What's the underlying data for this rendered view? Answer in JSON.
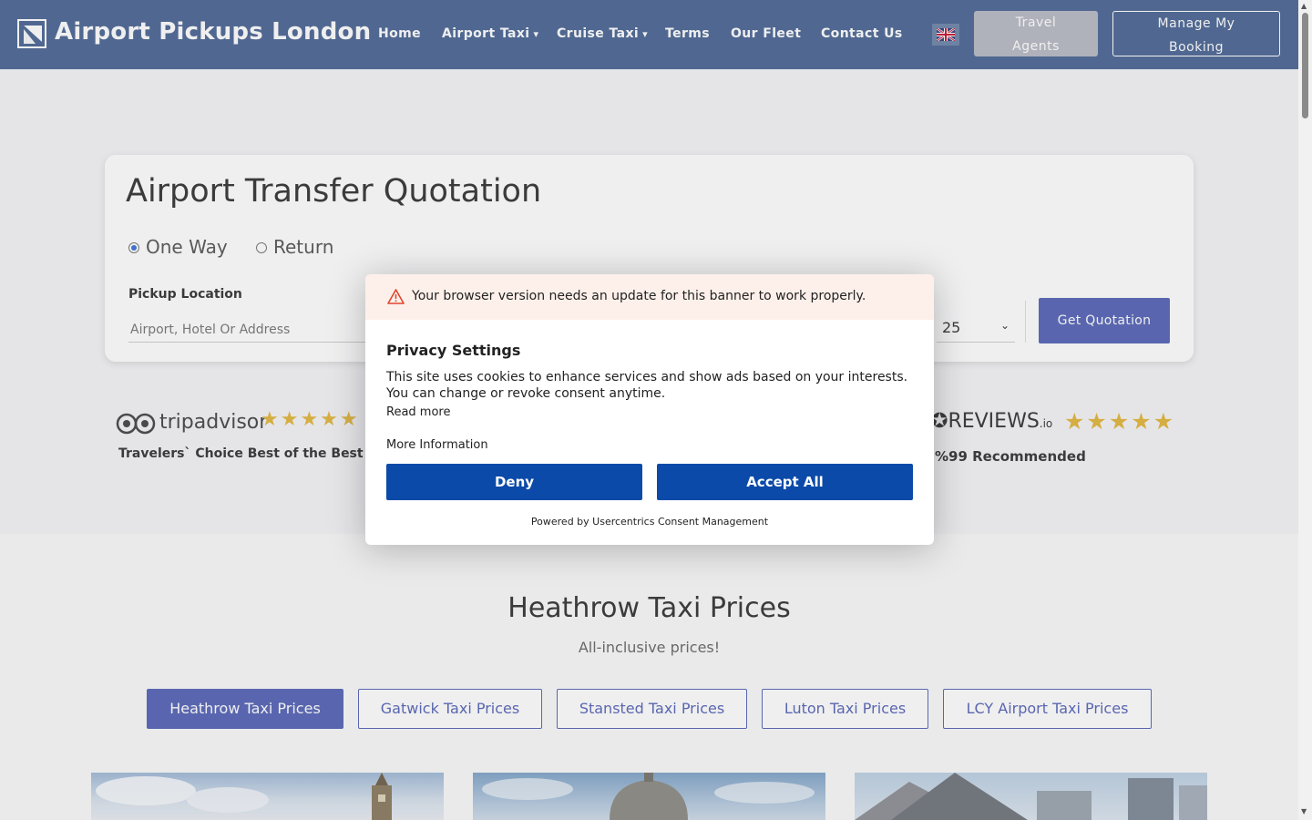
{
  "header": {
    "logo_text": "Airport Pickups London",
    "nav": [
      {
        "label": "Home",
        "has_dropdown": false
      },
      {
        "label": "Airport Taxi",
        "has_dropdown": true
      },
      {
        "label": "Cruise Taxi",
        "has_dropdown": true
      },
      {
        "label": "Terms",
        "has_dropdown": false
      },
      {
        "label": "Our Fleet",
        "has_dropdown": false
      },
      {
        "label": "Contact Us",
        "has_dropdown": false
      }
    ],
    "dropdown_arrow": "▾",
    "flag_icon": "uk-flag-icon",
    "travel_agents_line1": "Travel",
    "travel_agents_line2": "Agents",
    "manage_line1": "Manage My",
    "manage_line2": "Booking"
  },
  "quote": {
    "title": "Airport Transfer Quotation",
    "trip_options": [
      "One Way",
      "Return"
    ],
    "selected_trip": "One Way",
    "pickup_label": "Pickup Location",
    "pickup_placeholder": "Airport, Hotel Or Address",
    "time_value": "25",
    "submit_label": "Get Quotation"
  },
  "reviews": {
    "tripadvisor_name": "tripadvisor",
    "tripadvisor_stars": "★★★★★",
    "tripadvisor_caption": "Travelers` Choice Best of the Best 2023",
    "reviews_io_name": "REVIEWS",
    "reviews_io_suffix": ".io",
    "reviews_io_stars": "★★★★★",
    "reviews_io_caption": "%99 Recommended"
  },
  "prices": {
    "title": "Heathrow Taxi Prices",
    "subtitle": "All-inclusive prices!",
    "tabs": [
      "Heathrow Taxi Prices",
      "Gatwick Taxi Prices",
      "Stansted Taxi Prices",
      "Luton Taxi Prices",
      "LCY Airport Taxi Prices"
    ],
    "active_tab": "Heathrow Taxi Prices"
  },
  "consent": {
    "warning": "Your browser version needs an update for this banner to work properly.",
    "title": "Privacy Settings",
    "body": "This site uses cookies to enhance services and show ads based on your interests. You can change or revoke consent anytime.",
    "read_more": "Read more",
    "more_information": "More Information",
    "deny_label": "Deny",
    "accept_label": "Accept All",
    "powered_by": "Powered by Usercentrics Consent Management"
  },
  "colors": {
    "header_bg": "#4a6693",
    "accent": "#5563b5",
    "consent_button": "#0b4aa8",
    "star": "#e2b63b",
    "warning_bg": "#fdf0ea"
  }
}
